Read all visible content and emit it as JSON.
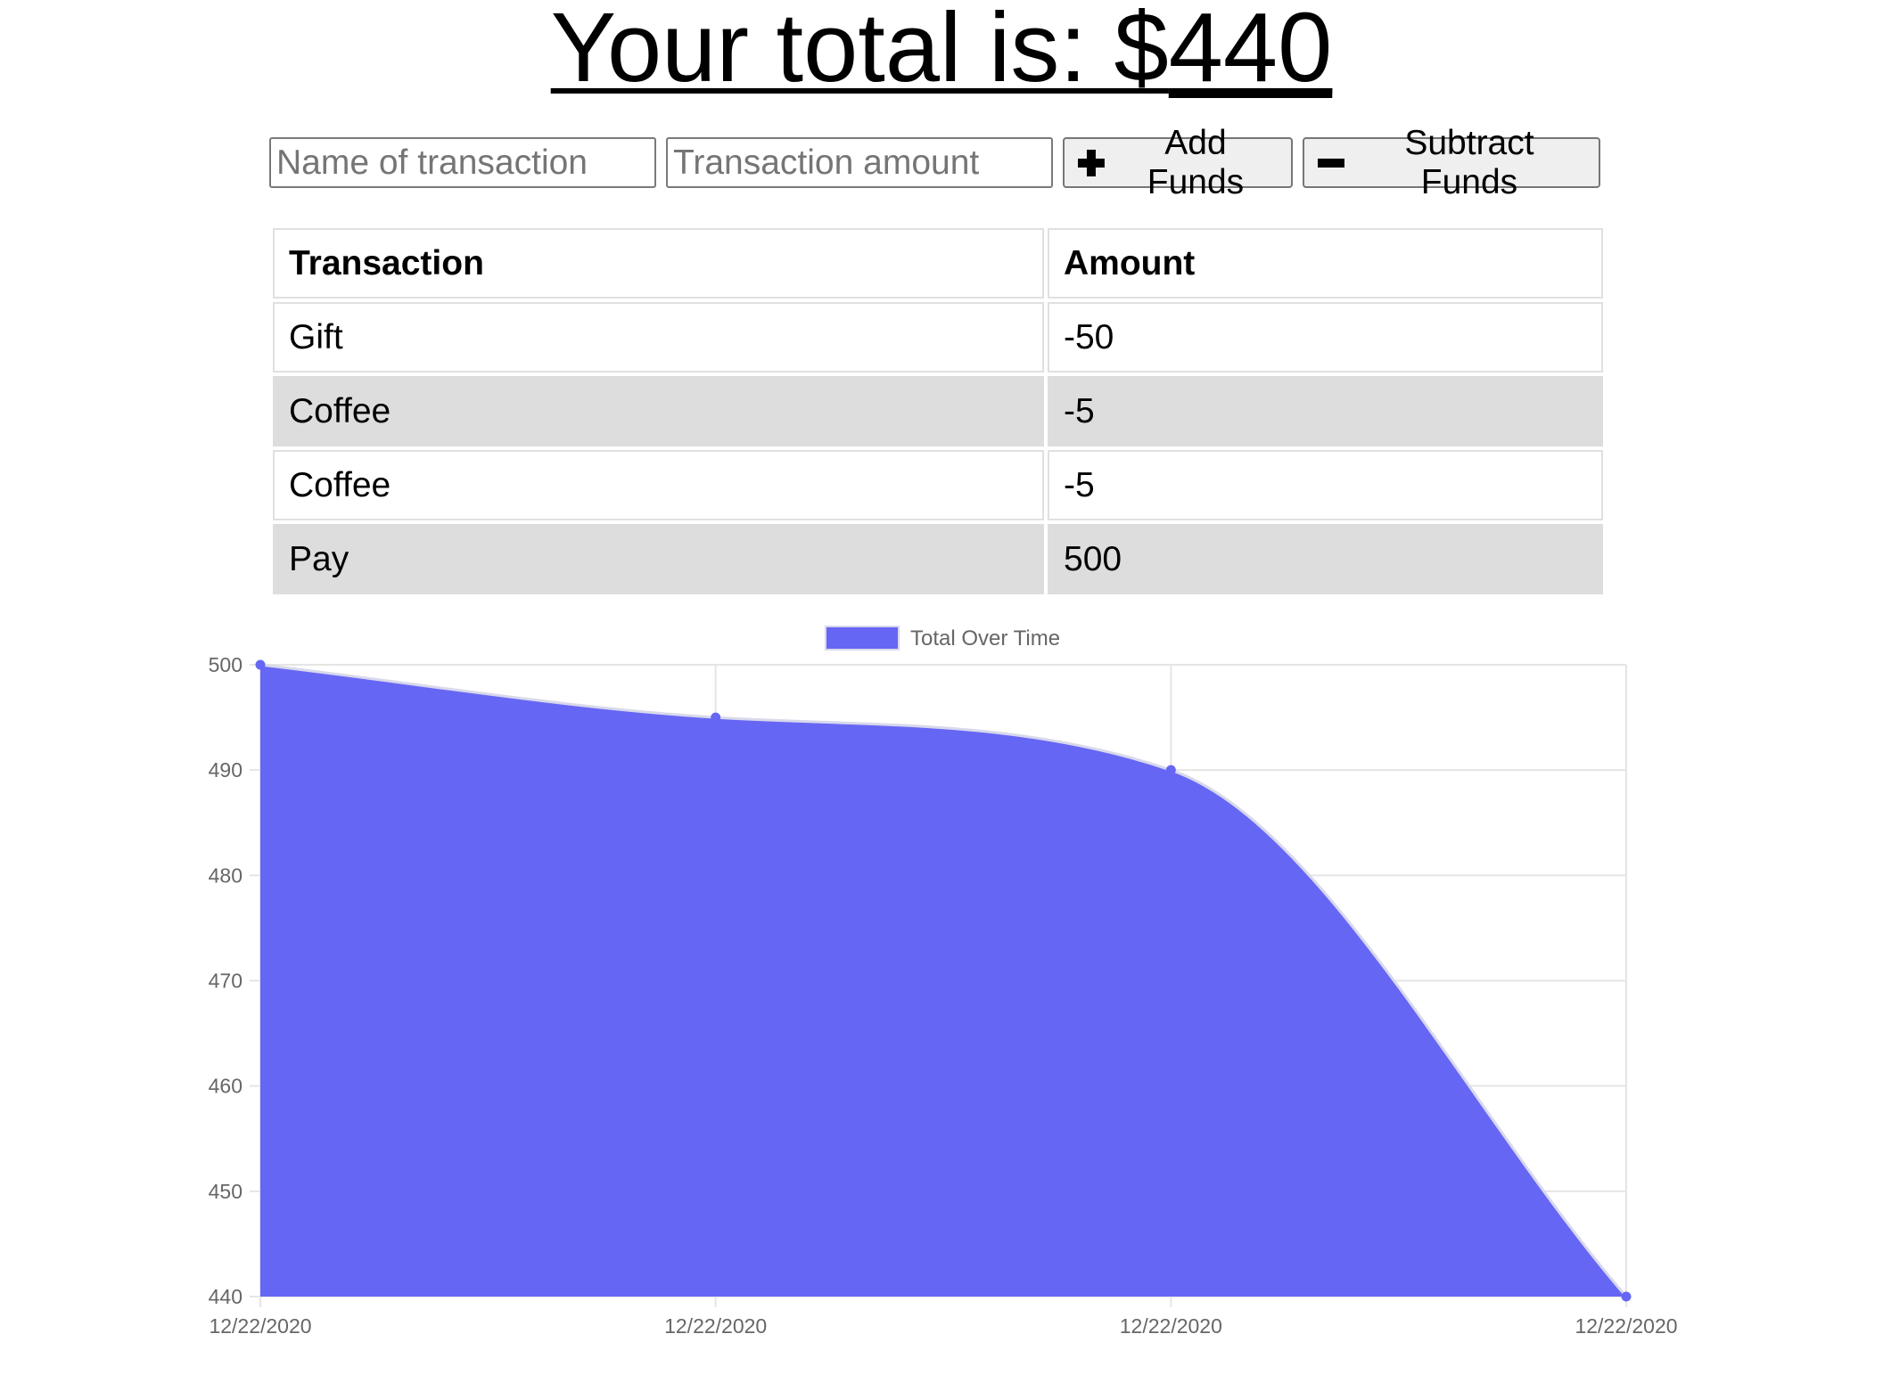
{
  "header": {
    "total_label": "Your total is: $",
    "total_value": "440"
  },
  "form": {
    "name_placeholder": "Name of transaction",
    "amount_placeholder": "Transaction amount",
    "add_label": "Add Funds",
    "subtract_label": "Subtract Funds",
    "add_icon": "plus-icon",
    "subtract_icon": "minus-icon"
  },
  "table": {
    "headers": [
      "Transaction",
      "Amount"
    ],
    "rows": [
      {
        "name": "Gift",
        "amount": "-50"
      },
      {
        "name": "Coffee",
        "amount": "-5"
      },
      {
        "name": "Coffee",
        "amount": "-5"
      },
      {
        "name": "Pay",
        "amount": "500"
      }
    ],
    "stripe_color": "#dddddd"
  },
  "chart_data": {
    "type": "area",
    "legend": {
      "label": "Total Over Time",
      "position": "top"
    },
    "categories": [
      "12/22/2020",
      "12/22/2020",
      "12/22/2020",
      "12/22/2020"
    ],
    "series": [
      {
        "name": "Total Over Time",
        "values": [
          500,
          495,
          490,
          440
        ],
        "color": "#6666f5"
      }
    ],
    "ylim": [
      440,
      500
    ],
    "yticks": [
      500,
      490,
      480,
      470,
      460,
      450,
      440
    ],
    "grid": true,
    "smooth": true
  }
}
